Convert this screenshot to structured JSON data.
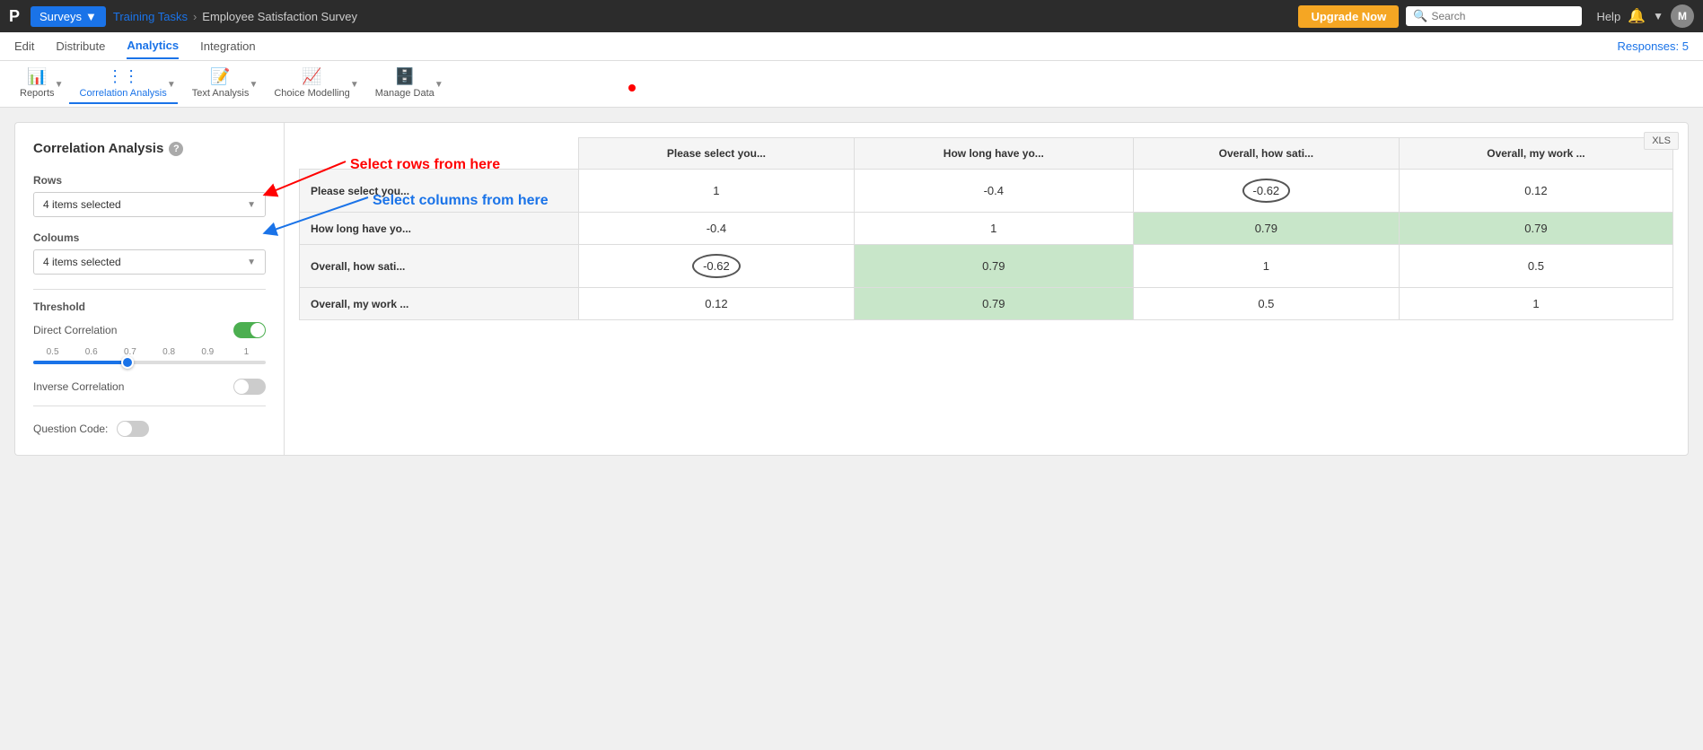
{
  "topbar": {
    "logo": "P",
    "surveys_label": "Surveys",
    "training_tasks": "Training Tasks",
    "survey_name": "Employee Satisfaction Survey",
    "upgrade_label": "Upgrade Now",
    "search_placeholder": "Search",
    "help_label": "Help",
    "user_initial": "M",
    "responses_label": "Responses: 5"
  },
  "secnav": {
    "items": [
      {
        "id": "edit",
        "label": "Edit",
        "active": false
      },
      {
        "id": "distribute",
        "label": "Distribute",
        "active": false
      },
      {
        "id": "analytics",
        "label": "Analytics",
        "active": true
      },
      {
        "id": "integration",
        "label": "Integration",
        "active": false
      }
    ]
  },
  "toolbar": {
    "items": [
      {
        "id": "reports",
        "icon": "📊",
        "label": "Reports",
        "active": false
      },
      {
        "id": "correlation",
        "icon": "⋯",
        "label": "Correlation Analysis",
        "active": true
      },
      {
        "id": "text",
        "icon": "📝",
        "label": "Text Analysis",
        "active": false
      },
      {
        "id": "choice",
        "icon": "📈",
        "label": "Choice Modelling",
        "active": false
      },
      {
        "id": "manage",
        "icon": "🗄️",
        "label": "Manage Data",
        "active": false
      }
    ]
  },
  "panel": {
    "title": "Correlation Analysis",
    "rows_label": "Rows",
    "rows_selected": "4 items selected",
    "columns_label": "Coloums",
    "columns_selected": "4 items selected",
    "threshold_label": "Threshold",
    "direct_correlation_label": "Direct Correlation",
    "direct_correlation_on": true,
    "inverse_correlation_label": "Inverse Correlation",
    "inverse_correlation_on": false,
    "slider_marks": [
      "0.5",
      "0.6",
      "0.7",
      "0.8",
      "0.9",
      "1"
    ],
    "slider_value": 0.65,
    "question_code_label": "Question Code:",
    "question_code_on": false
  },
  "annotations": {
    "red_text": "Select rows from here",
    "blue_text": "Select columns from here"
  },
  "table": {
    "columns": [
      "Please select you...",
      "How long have yo...",
      "Overall, how sati...",
      "Overall, my work ..."
    ],
    "rows": [
      {
        "label": "Please select you...",
        "cells": [
          {
            "value": "1",
            "highlight": false,
            "circled": false
          },
          {
            "value": "-0.4",
            "highlight": false,
            "circled": false
          },
          {
            "value": "-0.62",
            "highlight": false,
            "circled": true
          },
          {
            "value": "0.12",
            "highlight": false,
            "circled": false
          }
        ]
      },
      {
        "label": "How long have yo...",
        "cells": [
          {
            "value": "-0.4",
            "highlight": false,
            "circled": false
          },
          {
            "value": "1",
            "highlight": false,
            "circled": false
          },
          {
            "value": "0.79",
            "highlight": true,
            "circled": false
          },
          {
            "value": "0.79",
            "highlight": true,
            "circled": false
          }
        ]
      },
      {
        "label": "Overall, how sati...",
        "cells": [
          {
            "value": "-0.62",
            "highlight": false,
            "circled": true
          },
          {
            "value": "0.79",
            "highlight": true,
            "circled": false
          },
          {
            "value": "1",
            "highlight": false,
            "circled": false
          },
          {
            "value": "0.5",
            "highlight": false,
            "circled": false
          }
        ]
      },
      {
        "label": "Overall, my work ...",
        "cells": [
          {
            "value": "0.12",
            "highlight": false,
            "circled": false
          },
          {
            "value": "0.79",
            "highlight": true,
            "circled": false
          },
          {
            "value": "0.5",
            "highlight": false,
            "circled": false
          },
          {
            "value": "1",
            "highlight": false,
            "circled": false
          }
        ]
      }
    ]
  },
  "xls_label": "XLS"
}
